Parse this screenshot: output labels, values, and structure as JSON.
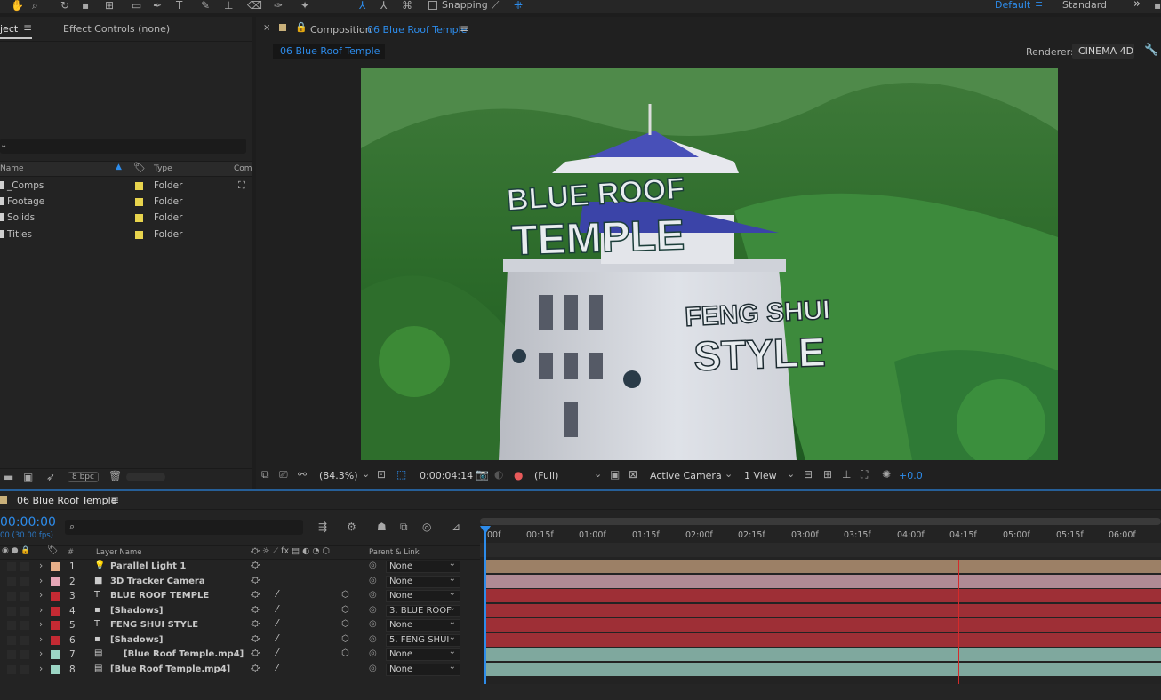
{
  "toolbar": {
    "snapping_label": "Snapping",
    "workspace_default": "Default",
    "workspace_standard": "Standard"
  },
  "project_panel": {
    "tab_project": "ject",
    "tab_effect_controls": "Effect Controls (none)",
    "columns": {
      "name": "Name",
      "type": "Type",
      "comment": "Com"
    },
    "items": [
      {
        "name": "_Comps",
        "type": "Folder",
        "label_color": "#e8d44d"
      },
      {
        "name": "Footage",
        "type": "Folder",
        "label_color": "#e8d44d"
      },
      {
        "name": "Solids",
        "type": "Folder",
        "label_color": "#e8d44d"
      },
      {
        "name": "Titles",
        "type": "Folder",
        "label_color": "#e8d44d"
      }
    ],
    "bpc": "8 bpc"
  },
  "composition_panel": {
    "title_prefix": "Composition",
    "comp_name": "06 Blue Roof Temple",
    "breadcrumb": "06 Blue Roof Temple",
    "renderer_label": "Renderer:",
    "renderer_value": "CINEMA 4D",
    "viewer_text": {
      "title1": "BLUE ROOF",
      "title2": "TEMPLE",
      "title3": "FENG SHUI",
      "title4": "STYLE"
    },
    "footer": {
      "zoom": "(84.3%)",
      "timecode": "0:00:04:14",
      "resolution": "(Full)",
      "camera": "Active Camera",
      "views": "1 View",
      "exposure": "+0.0"
    }
  },
  "timeline": {
    "tab_name": "06 Blue Roof Temple",
    "current_time": "00:00:00",
    "fps": "00 (30.00 fps)",
    "search_placeholder": "",
    "columns": {
      "layer_name": "Layer Name",
      "parent": "Parent & Link",
      "num": "#"
    },
    "ruler": [
      "00f",
      "00:15f",
      "01:00f",
      "01:15f",
      "02:00f",
      "02:15f",
      "03:00f",
      "03:15f",
      "04:00f",
      "04:15f",
      "05:00f",
      "05:15f",
      "06:00f"
    ],
    "layers": [
      {
        "num": "1",
        "name": "Parallel Light 1",
        "type_icon": "light-icon",
        "label_color": "#e8b08a",
        "parent": "None",
        "track_color": "#9c8066"
      },
      {
        "num": "2",
        "name": "3D Tracker Camera",
        "type_icon": "camera-icon",
        "label_color": "#e6a6b6",
        "parent": "None",
        "track_color": "#b08a94"
      },
      {
        "num": "3",
        "name": "BLUE ROOF TEMPLE",
        "type_icon": "text-icon",
        "label_color": "#c42a33",
        "parent": "None",
        "track_color": "#9e2f36"
      },
      {
        "num": "4",
        "name": "[Shadows]",
        "type_icon": "solid-icon",
        "label_color": "#c42a33",
        "parent": "3. BLUE ROOF",
        "track_color": "#9e2f36"
      },
      {
        "num": "5",
        "name": "FENG SHUI STYLE",
        "type_icon": "text-icon",
        "label_color": "#c42a33",
        "parent": "None",
        "track_color": "#9e2f36"
      },
      {
        "num": "6",
        "name": "[Shadows]",
        "type_icon": "solid-icon",
        "label_color": "#c42a33",
        "parent": "5. FENG SHUI",
        "track_color": "#9e2f36"
      },
      {
        "num": "7",
        "name": "[Blue Roof Temple.mp4]",
        "type_icon": "footage-icon",
        "label_color": "#9cd5c4",
        "parent": "None",
        "track_color": "#7fa89e"
      },
      {
        "num": "8",
        "name": "[Blue Roof Temple.mp4]",
        "type_icon": "footage-icon",
        "label_color": "#9cd5c4",
        "parent": "None",
        "track_color": "#7fa89e"
      }
    ]
  },
  "colors": {
    "accent": "#2d8ceb",
    "playhead": "#d42b2b"
  }
}
